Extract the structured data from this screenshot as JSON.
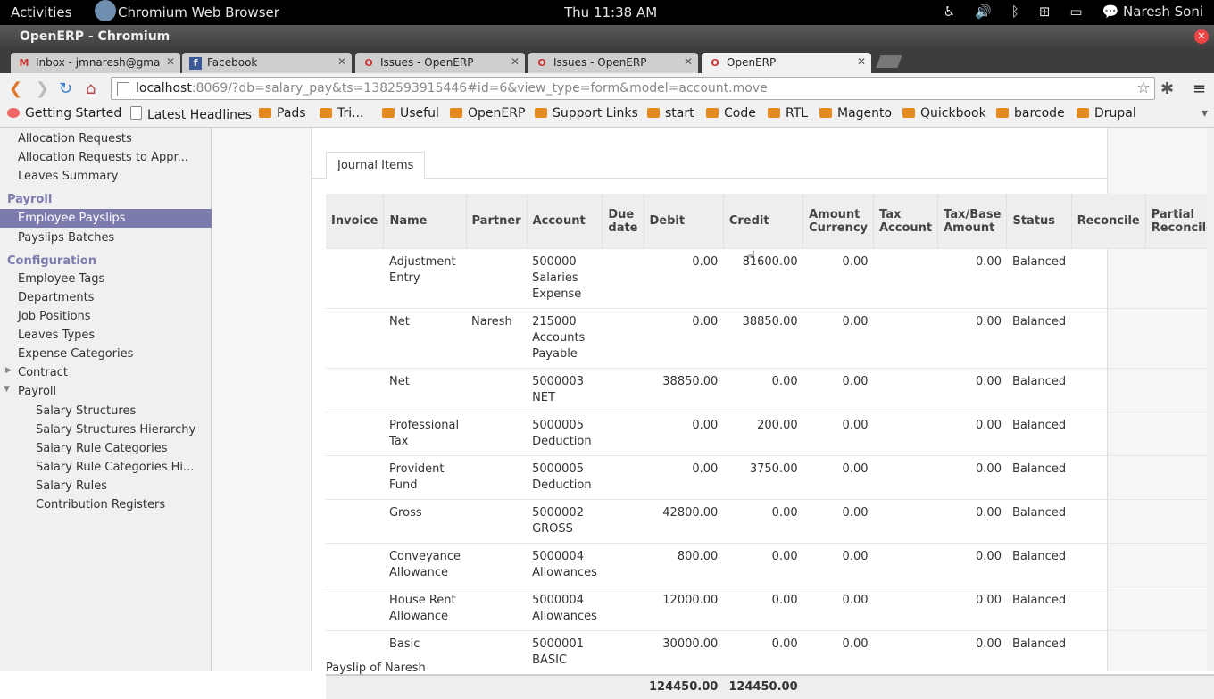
{
  "desktop": {
    "activities": "Activities",
    "app_name": "Chromium Web Browser",
    "clock": "Thu 11:38 AM",
    "user": "Naresh Soni"
  },
  "window": {
    "title": "OpenERP - Chromium"
  },
  "tabs": [
    {
      "label": "Inbox - jmnaresh@gmail.c",
      "icon": "gmail-icon",
      "active": false
    },
    {
      "label": "Facebook",
      "icon": "facebook-icon",
      "active": false
    },
    {
      "label": "Issues - OpenERP",
      "icon": "openerp-icon",
      "active": false
    },
    {
      "label": "Issues - OpenERP",
      "icon": "openerp-icon",
      "active": false
    },
    {
      "label": "OpenERP",
      "icon": "openerp-icon",
      "active": true
    }
  ],
  "address": {
    "host": "localhost",
    "rest": ":8069/?db=salary_pay&ts=1382593915446#id=6&view_type=form&model=account.move"
  },
  "bookmarks": [
    "Getting Started",
    "Latest Headlines",
    "Pads",
    "Tri...",
    "Useful",
    "OpenERP",
    "Support Links",
    "start",
    "Code",
    "RTL",
    "Magento",
    "Quickbook",
    "barcode",
    "Drupal"
  ],
  "sidebar": [
    {
      "label": "Allocation Requests",
      "kind": "item"
    },
    {
      "label": "Allocation Requests to Appr...",
      "kind": "item"
    },
    {
      "label": "Leaves Summary",
      "kind": "item"
    },
    {
      "label": "Payroll",
      "kind": "header"
    },
    {
      "label": "Employee Payslips",
      "kind": "selected"
    },
    {
      "label": "Payslips Batches",
      "kind": "item"
    },
    {
      "label": "Configuration",
      "kind": "header"
    },
    {
      "label": "Employee Tags",
      "kind": "item"
    },
    {
      "label": "Departments",
      "kind": "item"
    },
    {
      "label": "Job Positions",
      "kind": "item"
    },
    {
      "label": "Leaves Types",
      "kind": "item"
    },
    {
      "label": "Expense Categories",
      "kind": "item"
    },
    {
      "label": "Contract",
      "kind": "collapsed"
    },
    {
      "label": "Payroll",
      "kind": "expanded"
    },
    {
      "label": "Salary Structures",
      "kind": "sub"
    },
    {
      "label": "Salary Structures Hierarchy",
      "kind": "sub"
    },
    {
      "label": "Salary Rule Categories",
      "kind": "sub"
    },
    {
      "label": "Salary Rule Categories Hi...",
      "kind": "sub"
    },
    {
      "label": "Salary Rules",
      "kind": "sub"
    },
    {
      "label": "Contribution Registers",
      "kind": "sub"
    }
  ],
  "form": {
    "notebook_tab": "Journal Items",
    "below_text": "Payslip of Naresh"
  },
  "grid": {
    "columns": [
      "Invoice",
      "Name",
      "Partner",
      "Account",
      "Due date",
      "Debit",
      "Credit",
      "Amount Currency",
      "Tax Account",
      "Tax/Base Amount",
      "Status",
      "Reconcile",
      "Partial Reconcile"
    ],
    "rows": [
      {
        "invoice": "",
        "name": "Adjustment Entry",
        "partner": "",
        "account": "500000 Salaries Expense",
        "due": "",
        "debit": "0.00",
        "credit": "81600.00",
        "amount_currency": "0.00",
        "tax_account": "",
        "tax_base": "0.00",
        "status": "Balanced",
        "reconcile": "",
        "partial": ""
      },
      {
        "invoice": "",
        "name": "Net",
        "partner": "Naresh",
        "account": "215000 Accounts Payable",
        "due": "",
        "debit": "0.00",
        "credit": "38850.00",
        "amount_currency": "0.00",
        "tax_account": "",
        "tax_base": "0.00",
        "status": "Balanced",
        "reconcile": "",
        "partial": ""
      },
      {
        "invoice": "",
        "name": "Net",
        "partner": "",
        "account": "5000003 NET",
        "due": "",
        "debit": "38850.00",
        "credit": "0.00",
        "amount_currency": "0.00",
        "tax_account": "",
        "tax_base": "0.00",
        "status": "Balanced",
        "reconcile": "",
        "partial": ""
      },
      {
        "invoice": "",
        "name": "Professional Tax",
        "partner": "",
        "account": "5000005 Deduction",
        "due": "",
        "debit": "0.00",
        "credit": "200.00",
        "amount_currency": "0.00",
        "tax_account": "",
        "tax_base": "0.00",
        "status": "Balanced",
        "reconcile": "",
        "partial": ""
      },
      {
        "invoice": "",
        "name": "Provident Fund",
        "partner": "",
        "account": "5000005 Deduction",
        "due": "",
        "debit": "0.00",
        "credit": "3750.00",
        "amount_currency": "0.00",
        "tax_account": "",
        "tax_base": "0.00",
        "status": "Balanced",
        "reconcile": "",
        "partial": ""
      },
      {
        "invoice": "",
        "name": "Gross",
        "partner": "",
        "account": "5000002 GROSS",
        "due": "",
        "debit": "42800.00",
        "credit": "0.00",
        "amount_currency": "0.00",
        "tax_account": "",
        "tax_base": "0.00",
        "status": "Balanced",
        "reconcile": "",
        "partial": ""
      },
      {
        "invoice": "",
        "name": "Conveyance Allowance",
        "partner": "",
        "account": "5000004 Allowances",
        "due": "",
        "debit": "800.00",
        "credit": "0.00",
        "amount_currency": "0.00",
        "tax_account": "",
        "tax_base": "0.00",
        "status": "Balanced",
        "reconcile": "",
        "partial": ""
      },
      {
        "invoice": "",
        "name": "House Rent Allowance",
        "partner": "",
        "account": "5000004 Allowances",
        "due": "",
        "debit": "12000.00",
        "credit": "0.00",
        "amount_currency": "0.00",
        "tax_account": "",
        "tax_base": "0.00",
        "status": "Balanced",
        "reconcile": "",
        "partial": ""
      },
      {
        "invoice": "",
        "name": "Basic",
        "partner": "",
        "account": "5000001 BASIC",
        "due": "",
        "debit": "30000.00",
        "credit": "0.00",
        "amount_currency": "0.00",
        "tax_account": "",
        "tax_base": "0.00",
        "status": "Balanced",
        "reconcile": "",
        "partial": ""
      }
    ],
    "totals": {
      "debit": "124450.00",
      "credit": "124450.00"
    }
  },
  "colors": {
    "accent": "#7c7bad",
    "chrome_dark": "#3d3d3d"
  }
}
